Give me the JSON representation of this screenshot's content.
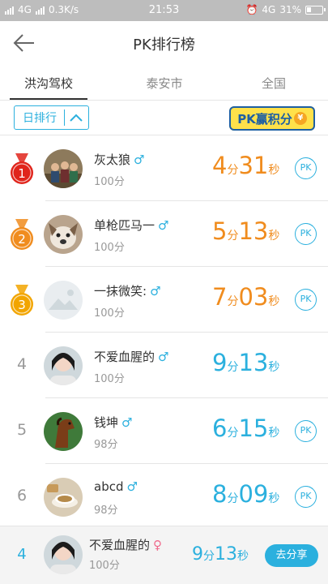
{
  "statusbar": {
    "network_left": "4G",
    "speed": "0.3K/s",
    "time": "21:53",
    "network_right": "4G",
    "battery": "31%"
  },
  "header": {
    "title": "PK排行榜"
  },
  "tabs": [
    {
      "label": "洪沟驾校",
      "active": true
    },
    {
      "label": "泰安市",
      "active": false
    },
    {
      "label": "全国",
      "active": false
    }
  ],
  "filter": {
    "label": "日排行"
  },
  "pk_logo": {
    "text": "PK赢积分",
    "coin": "¥"
  },
  "colors": {
    "accent": "#2bb0de",
    "orange": "#f08c1e",
    "gold": "#f2a500",
    "red": "#e0241b"
  },
  "rows": [
    {
      "rank": "1",
      "medal": "red",
      "name": "灰太狼",
      "gender": "♂",
      "score": "100分",
      "min": "4",
      "min_unit": "分",
      "sec": "31",
      "sec_unit": "秒",
      "time_color": "orange",
      "pk": "PK",
      "avatar": "photo-group"
    },
    {
      "rank": "2",
      "medal": "orange",
      "name": "单枪匹马一",
      "gender": "♂",
      "score": "100分",
      "min": "5",
      "min_unit": "分",
      "sec": "13",
      "sec_unit": "秒",
      "time_color": "orange",
      "pk": "PK",
      "avatar": "photo-dog"
    },
    {
      "rank": "3",
      "medal": "gold",
      "name": "一抹微笑:",
      "gender": "♂",
      "score": "100分",
      "min": "7",
      "min_unit": "分",
      "sec": "03",
      "sec_unit": "秒",
      "time_color": "orange",
      "pk": "PK",
      "avatar": "placeholder"
    },
    {
      "rank": "4",
      "medal": "",
      "name": "不爱血腥的",
      "gender": "♂",
      "score": "100分",
      "min": "9",
      "min_unit": "分",
      "sec": "13",
      "sec_unit": "秒",
      "time_color": "blue",
      "pk": "",
      "avatar": "photo-girl"
    },
    {
      "rank": "5",
      "medal": "",
      "name": "钱坤",
      "gender": "♂",
      "score": "98分",
      "min": "6",
      "min_unit": "分",
      "sec": "15",
      "sec_unit": "秒",
      "time_color": "blue",
      "pk": "PK",
      "avatar": "photo-horse"
    },
    {
      "rank": "6",
      "medal": "",
      "name": "abcd",
      "gender": "♂",
      "score": "98分",
      "min": "8",
      "min_unit": "分",
      "sec": "09",
      "sec_unit": "秒",
      "time_color": "blue",
      "pk": "PK",
      "avatar": "photo-coffee"
    }
  ],
  "footer": {
    "rank": "4",
    "name": "不爱血腥的",
    "gender": "♀",
    "score": "100分",
    "min": "9",
    "min_unit": "分",
    "sec": "13",
    "sec_unit": "秒",
    "share_label": "去分享"
  }
}
